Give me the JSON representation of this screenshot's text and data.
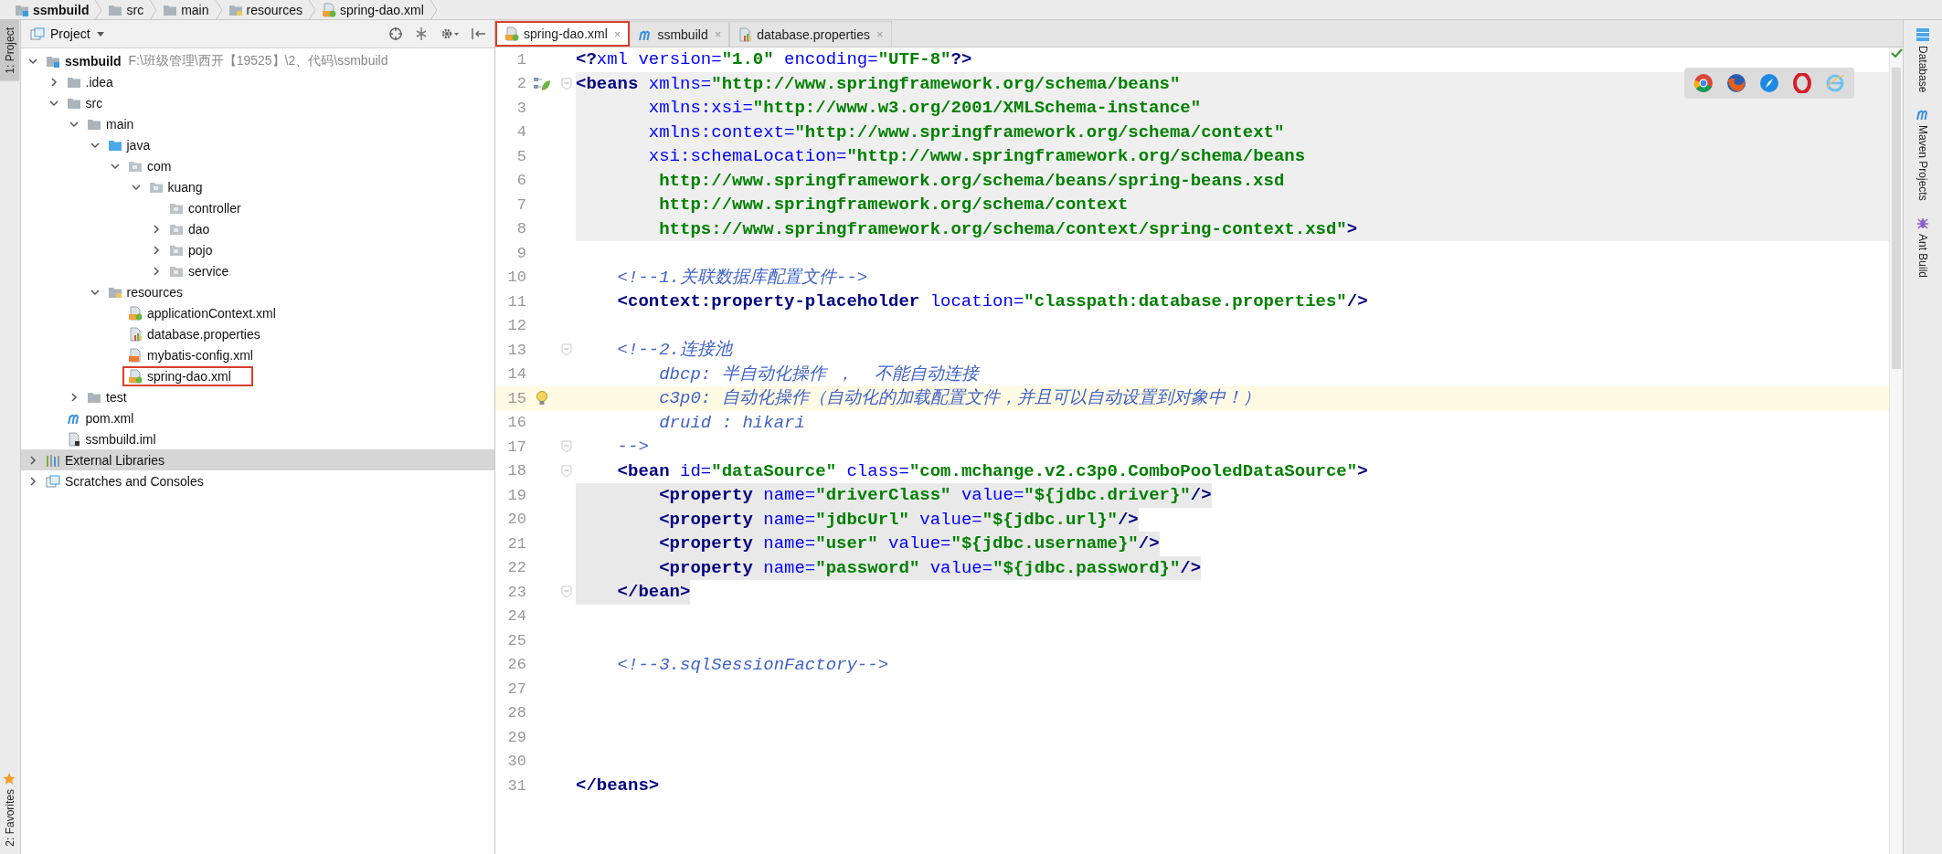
{
  "breadcrumbs": [
    {
      "label": "ssmbuild",
      "kind": "module"
    },
    {
      "label": "src",
      "kind": "folder"
    },
    {
      "label": "main",
      "kind": "folder"
    },
    {
      "label": "resources",
      "kind": "resources"
    },
    {
      "label": "spring-dao.xml",
      "kind": "spring"
    }
  ],
  "left_strip": {
    "top": [
      {
        "label": "1: Project",
        "selected": true
      }
    ],
    "bottom": [
      {
        "label": "2: Favorites",
        "selected": false
      }
    ]
  },
  "project": {
    "title": "Project",
    "tree": [
      {
        "label": "ssmbuild",
        "path": "F:\\班级管理\\西开【19525】\\2、代码\\ssmbuild",
        "kind": "module",
        "expanded": true,
        "selected": false,
        "children": [
          {
            "label": ".idea",
            "kind": "folder",
            "expanded": false,
            "selected": false
          },
          {
            "label": "src",
            "kind": "folder",
            "expanded": true,
            "selected": false,
            "children": [
              {
                "label": "main",
                "kind": "folder",
                "expanded": true,
                "selected": false,
                "children": [
                  {
                    "label": "java",
                    "kind": "source",
                    "expanded": true,
                    "selected": false,
                    "children": [
                      {
                        "label": "com",
                        "kind": "package",
                        "expanded": true,
                        "selected": false,
                        "children": [
                          {
                            "label": "kuang",
                            "kind": "package",
                            "expanded": true,
                            "selected": false,
                            "children": [
                              {
                                "label": "controller",
                                "kind": "package",
                                "selected": false
                              },
                              {
                                "label": "dao",
                                "kind": "package",
                                "expanded": false,
                                "selected": false
                              },
                              {
                                "label": "pojo",
                                "kind": "package",
                                "expanded": false,
                                "selected": false
                              },
                              {
                                "label": "service",
                                "kind": "package",
                                "expanded": false,
                                "selected": false
                              }
                            ]
                          }
                        ]
                      }
                    ]
                  },
                  {
                    "label": "resources",
                    "kind": "resources",
                    "expanded": true,
                    "selected": false,
                    "children": [
                      {
                        "label": "applicationContext.xml",
                        "kind": "spring",
                        "selected": false
                      },
                      {
                        "label": "database.properties",
                        "kind": "properties",
                        "selected": false
                      },
                      {
                        "label": "mybatis-config.xml",
                        "kind": "xml",
                        "selected": false
                      },
                      {
                        "label": "spring-dao.xml",
                        "kind": "spring",
                        "selected": false,
                        "boxed": true
                      }
                    ]
                  }
                ]
              },
              {
                "label": "test",
                "kind": "folder",
                "expanded": false,
                "selected": false
              }
            ]
          },
          {
            "label": "pom.xml",
            "kind": "maven",
            "selected": false
          },
          {
            "label": "ssmbuild.iml",
            "kind": "iml",
            "selected": false
          }
        ]
      },
      {
        "label": "External Libraries",
        "kind": "libraries",
        "expanded": false,
        "selected": true
      },
      {
        "label": "Scratches and Consoles",
        "kind": "scratches",
        "expanded": false,
        "selected": false
      }
    ]
  },
  "editor": {
    "tabs": [
      {
        "label": "spring-dao.xml",
        "kind": "spring",
        "close": "×",
        "selected": true,
        "boxed": true
      },
      {
        "label": "ssmbuild",
        "kind": "maven",
        "close": "×",
        "selected": false,
        "boxed": false
      },
      {
        "label": "database.properties",
        "kind": "properties",
        "close": "×",
        "selected": false,
        "boxed": false
      }
    ],
    "lines": [
      {
        "number": "1",
        "fold": false,
        "current": false,
        "shaded": false,
        "text_shaded": false,
        "tokens": [
          {
            "kind": "tag",
            "text": "<?"
          },
          {
            "kind": "attr",
            "text": "xml version="
          },
          {
            "kind": "value",
            "text": "\"1.0\""
          },
          {
            "kind": "attr",
            "text": " encoding="
          },
          {
            "kind": "value",
            "text": "\"UTF-8\""
          },
          {
            "kind": "tag",
            "text": "?>"
          }
        ]
      },
      {
        "number": "2",
        "fold": true,
        "current": false,
        "shaded": true,
        "text_shaded": false,
        "tokens": [
          {
            "kind": "tag",
            "text": "<beans"
          },
          {
            "kind": "attr",
            "text": " xmlns="
          },
          {
            "kind": "value",
            "text": "\"http://www.springframework.org/schema/beans\""
          }
        ]
      },
      {
        "number": "3",
        "fold": false,
        "current": false,
        "shaded": true,
        "text_shaded": false,
        "tokens": [
          {
            "kind": "attr",
            "text": "       xmlns:xsi="
          },
          {
            "kind": "value",
            "text": "\"http://www.w3.org/2001/XMLSchema-instance\""
          }
        ]
      },
      {
        "number": "4",
        "fold": false,
        "current": false,
        "shaded": true,
        "text_shaded": false,
        "tokens": [
          {
            "kind": "attr",
            "text": "       xmlns:context="
          },
          {
            "kind": "value",
            "text": "\"http://www.springframework.org/schema/context\""
          }
        ]
      },
      {
        "number": "5",
        "fold": false,
        "current": false,
        "shaded": true,
        "text_shaded": false,
        "tokens": [
          {
            "kind": "attr",
            "text": "       xsi:schemaLocation="
          },
          {
            "kind": "value",
            "text": "\"http://www.springframework.org/schema/beans"
          }
        ]
      },
      {
        "number": "6",
        "fold": false,
        "current": false,
        "shaded": true,
        "text_shaded": false,
        "tokens": [
          {
            "kind": "value",
            "text": "        http://www.springframework.org/schema/beans/spring-beans.xsd"
          }
        ]
      },
      {
        "number": "7",
        "fold": false,
        "current": false,
        "shaded": true,
        "text_shaded": false,
        "tokens": [
          {
            "kind": "value",
            "text": "        http://www.springframework.org/schema/context"
          }
        ]
      },
      {
        "number": "8",
        "fold": false,
        "current": false,
        "shaded": true,
        "text_shaded": false,
        "tokens": [
          {
            "kind": "value",
            "text": "        https://www.springframework.org/schema/context/spring-context.xsd\""
          },
          {
            "kind": "tag",
            "text": ">"
          }
        ]
      },
      {
        "number": "9",
        "fold": false,
        "current": false,
        "shaded": false
      },
      {
        "number": "10",
        "fold": false,
        "current": false,
        "shaded": false,
        "text_shaded": false,
        "tokens": [
          {
            "kind": "comment",
            "text": "    <!--1.关联数据库配置文件-->"
          }
        ]
      },
      {
        "number": "11",
        "fold": false,
        "current": false,
        "shaded": false,
        "text_shaded": false,
        "tokens": [
          {
            "kind": "tag",
            "text": "    <context:property-placeholder"
          },
          {
            "kind": "attr",
            "text": " location="
          },
          {
            "kind": "value",
            "text": "\"classpath:database.properties\""
          },
          {
            "kind": "tag",
            "text": "/>"
          }
        ]
      },
      {
        "number": "12",
        "fold": false,
        "current": false,
        "shaded": false
      },
      {
        "number": "13",
        "fold": true,
        "current": false,
        "shaded": false,
        "text_shaded": false,
        "tokens": [
          {
            "kind": "comment",
            "text": "    <!--2.连接池"
          }
        ]
      },
      {
        "number": "14",
        "fold": false,
        "current": false,
        "shaded": false,
        "text_shaded": false,
        "tokens": [
          {
            "kind": "comment",
            "text": "        dbcp: 半自动化操作 ，  不能自动连接"
          }
        ]
      },
      {
        "number": "15",
        "fold": false,
        "current": true,
        "shaded": false,
        "text_shaded": false,
        "tokens": [
          {
            "kind": "comment",
            "text": "        c3p0: 自动化操作（自动化的加载配置文件，并且可以自动设置到对象中！）"
          }
        ]
      },
      {
        "number": "16",
        "fold": false,
        "current": false,
        "shaded": false,
        "text_shaded": false,
        "tokens": [
          {
            "kind": "comment",
            "text": "        druid : hikari"
          }
        ]
      },
      {
        "number": "17",
        "fold": true,
        "current": false,
        "shaded": false,
        "text_shaded": false,
        "tokens": [
          {
            "kind": "comment",
            "text": "    -->"
          }
        ]
      },
      {
        "number": "18",
        "fold": true,
        "current": false,
        "shaded": false,
        "text_shaded": false,
        "tokens": [
          {
            "kind": "tag",
            "text": "    <bean"
          },
          {
            "kind": "attr",
            "text": " id="
          },
          {
            "kind": "value",
            "text": "\"dataSource\""
          },
          {
            "kind": "attr",
            "text": " class="
          },
          {
            "kind": "value",
            "text": "\"com.mchange.v2.c3p0.ComboPooledDataSource\""
          },
          {
            "kind": "tag",
            "text": ">"
          }
        ]
      },
      {
        "number": "19",
        "fold": false,
        "current": false,
        "shaded": false,
        "text_shaded": true,
        "tokens": [
          {
            "kind": "tag",
            "text": "        <property"
          },
          {
            "kind": "attr",
            "text": " name="
          },
          {
            "kind": "value",
            "text": "\"driverClass\""
          },
          {
            "kind": "attr",
            "text": " value="
          },
          {
            "kind": "value",
            "text": "\"${jdbc.driver}\""
          },
          {
            "kind": "tag",
            "text": "/>"
          }
        ]
      },
      {
        "number": "20",
        "fold": false,
        "current": false,
        "shaded": false,
        "text_shaded": true,
        "tokens": [
          {
            "kind": "tag",
            "text": "        <property"
          },
          {
            "kind": "attr",
            "text": " name="
          },
          {
            "kind": "value",
            "text": "\"jdbcUrl\""
          },
          {
            "kind": "attr",
            "text": " value="
          },
          {
            "kind": "value",
            "text": "\"${jdbc.url}\""
          },
          {
            "kind": "tag",
            "text": "/>"
          }
        ]
      },
      {
        "number": "21",
        "fold": false,
        "current": false,
        "shaded": false,
        "text_shaded": true,
        "tokens": [
          {
            "kind": "tag",
            "text": "        <property"
          },
          {
            "kind": "attr",
            "text": " name="
          },
          {
            "kind": "value",
            "text": "\"user\""
          },
          {
            "kind": "attr",
            "text": " value="
          },
          {
            "kind": "value",
            "text": "\"${jdbc.username}\""
          },
          {
            "kind": "tag",
            "text": "/>"
          }
        ]
      },
      {
        "number": "22",
        "fold": false,
        "current": false,
        "shaded": false,
        "text_shaded": true,
        "tokens": [
          {
            "kind": "tag",
            "text": "        <property"
          },
          {
            "kind": "attr",
            "text": " name="
          },
          {
            "kind": "value",
            "text": "\"password\""
          },
          {
            "kind": "attr",
            "text": " value="
          },
          {
            "kind": "value",
            "text": "\"${jdbc.password}\""
          },
          {
            "kind": "tag",
            "text": "/>"
          }
        ]
      },
      {
        "number": "23",
        "fold": true,
        "current": false,
        "shaded": false,
        "text_shaded": true,
        "tokens": [
          {
            "kind": "tag",
            "text": "    </bean>"
          }
        ]
      },
      {
        "number": "24",
        "fold": false,
        "current": false,
        "shaded": false
      },
      {
        "number": "25",
        "fold": false,
        "current": false,
        "shaded": false
      },
      {
        "number": "26",
        "fold": false,
        "current": false,
        "shaded": false,
        "text_shaded": false,
        "tokens": [
          {
            "kind": "comment",
            "text": "    <!--3.sqlSessionFactory-->"
          }
        ]
      },
      {
        "number": "27",
        "fold": false,
        "current": false,
        "shaded": false
      },
      {
        "number": "28",
        "fold": false,
        "current": false,
        "shaded": false
      },
      {
        "number": "29",
        "fold": false,
        "current": false,
        "shaded": false
      },
      {
        "number": "30",
        "fold": false,
        "current": false,
        "shaded": false
      },
      {
        "number": "31",
        "fold": false,
        "current": false,
        "shaded": false,
        "text_shaded": false,
        "tokens": [
          {
            "kind": "tag",
            "text": "</beans>"
          }
        ]
      }
    ]
  },
  "right_strip": [
    {
      "label": "Database",
      "kind": "database"
    },
    {
      "label": "Maven Projects",
      "kind": "maven"
    },
    {
      "label": "Ant Build",
      "kind": "ant"
    }
  ]
}
